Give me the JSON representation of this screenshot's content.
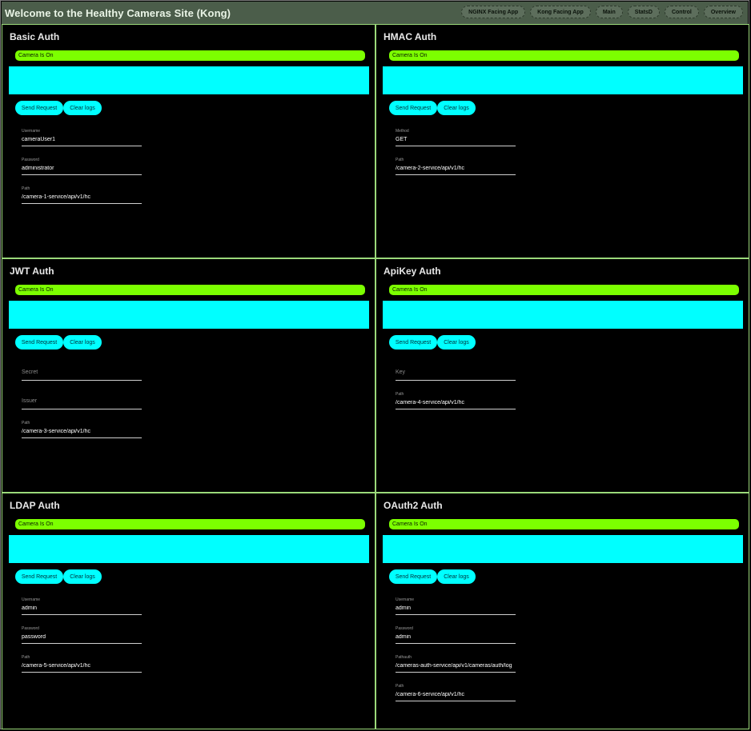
{
  "header": {
    "title": "Welcome to the Healthy Cameras Site (Kong)",
    "nav": [
      {
        "label": "NGINX Facing App"
      },
      {
        "label": "Kong Facing App"
      },
      {
        "label": "Main"
      },
      {
        "label": "StatsD"
      },
      {
        "label": "Control"
      },
      {
        "label": "Overview"
      }
    ]
  },
  "common": {
    "status": "Camera Is On",
    "send_label": "Send Request",
    "clear_label": "Clear logs"
  },
  "panels": [
    {
      "title": "Basic Auth",
      "fields": [
        {
          "label": "Username",
          "value": "cameraUser1"
        },
        {
          "label": "Password",
          "value": "administrator"
        },
        {
          "label": "Path",
          "value": "/camera-1-service/api/v1/hc"
        }
      ]
    },
    {
      "title": "HMAC Auth",
      "fields": [
        {
          "label": "Method",
          "value": "GET"
        },
        {
          "label": "Path",
          "value": "/camera-2-service/api/v1/hc"
        }
      ]
    },
    {
      "title": "JWT Auth",
      "fields": [
        {
          "placeholder": "Secret"
        },
        {
          "placeholder": "Issuer"
        },
        {
          "label": "Path",
          "value": "/camera-3-service/api/v1/hc"
        }
      ]
    },
    {
      "title": "ApiKey Auth",
      "fields": [
        {
          "placeholder": "Key"
        },
        {
          "label": "Path",
          "value": "/camera-4-service/api/v1/hc"
        }
      ]
    },
    {
      "title": "LDAP Auth",
      "fields": [
        {
          "label": "Username",
          "value": "admin"
        },
        {
          "label": "Password",
          "value": "password"
        },
        {
          "label": "Path",
          "value": "/camera-5-service/api/v1/hc"
        }
      ]
    },
    {
      "title": "OAuth2 Auth",
      "fields": [
        {
          "label": "Username",
          "value": "admin"
        },
        {
          "label": "Password",
          "value": "admin"
        },
        {
          "label": "Pathauth",
          "value": "/cameras-auth-service/api/v1/cameras/auth/log"
        },
        {
          "label": "Path",
          "value": "/camera-6-service/api/v1/hc"
        }
      ]
    }
  ],
  "colors": {
    "status_bar": "#7cff00",
    "camera_view": "#00ffff",
    "panel_border": "#9bd97a",
    "header_bg": "#4b5d4a"
  }
}
